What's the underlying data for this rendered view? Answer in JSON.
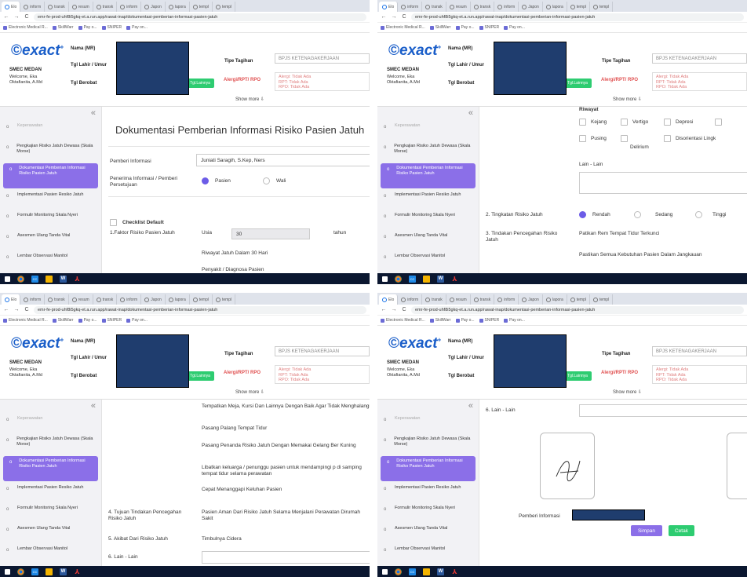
{
  "browser": {
    "tabs": [
      "Elo",
      "inform",
      "transk",
      "resum",
      "transk",
      "inform",
      "Japon",
      "lapora",
      "templ",
      "templ"
    ],
    "url": "emr-fe-prod-uhf8i5gkq-et.a.run.app/rawat-inap/dokumentasi-pemberian-informasi-pasien-jatuh",
    "bookmarks": [
      "Electronic Medical R...",
      "SkillWarr",
      "Pay o...",
      "SNIPER",
      "Pay on..."
    ]
  },
  "header": {
    "logo": "exact",
    "logo_sup": "+",
    "clinic": "SMEC MEDAN",
    "welcome": "Welcome, Eka Oktafianita, A.Md",
    "labels": {
      "nama": "Nama (MR)",
      "tgl_lahir": "Tgl Lahir / Umur",
      "tgl_berobat": "Tgl Berobat",
      "tipe": "Tipe Tagihan",
      "alergi": "Alergi/RPT/ RPO"
    },
    "tgl_lainnya": "Tgl.Lainnya",
    "tipe_value": "BPJS KETENAGAKERJAAN",
    "alergi_lines": [
      "Alergi: Tidak Ada",
      "RPT: Tidak Ada",
      "RPO: Tidak Ada"
    ],
    "show_more": "Show more ⇩"
  },
  "sidebar": {
    "items": [
      {
        "label": "Keperawatan",
        "state": "faded"
      },
      {
        "label": "Pengkajian Risiko Jatuh Dewasa (Skala Morse)",
        "state": "normal"
      },
      {
        "label": "Dokumentasi Pemberian Informasi Risiko Pasien Jatuh",
        "state": "active"
      },
      {
        "label": "Implementasi Pasien Resiko Jatuh",
        "state": "normal"
      },
      {
        "label": "Formulir Monitoring Skala Nyeri",
        "state": "normal"
      },
      {
        "label": "Asesmen Ulang Tanda Vital",
        "state": "normal"
      },
      {
        "label": "Lembar Observasi Manitol",
        "state": "normal"
      }
    ]
  },
  "q1": {
    "title": "Dokumentasi Pemberian Informasi Risiko Pasien Jatuh",
    "pemberi_label": "Pemberi Informasi",
    "pemberi_value": "Juniati Saragih, S.Kep, Ners",
    "penerima_label": "Penerima Informasi / Pemberi Persetujuan",
    "opt_pasien": "Pasien",
    "opt_wali": "Wali",
    "checklist": "Checklist Default",
    "faktor": "1.Faktor Risiko Pasien Jatuh",
    "usia_label": "Usia",
    "usia_value": "30",
    "usia_unit": "tahun",
    "riwayat": "Riwayat Jatuh Dalam 30 Hari",
    "penyakit": "Penyakit / Diagnosa Pasien"
  },
  "q2": {
    "riwayat": "Riwayat",
    "opts": [
      "Kejang",
      "Vertigo",
      "Depresi",
      "Pusing",
      "Disorientasi Lingk",
      "Delirium"
    ],
    "lain": "Lain - Lain",
    "tingkatan": "2. Tingkatan Risiko Jatuh",
    "rendah": "Rendah",
    "sedang": "Sedang",
    "tinggi": "Tinggi",
    "tindakan": "3. Tindakan Pencegahan Risiko Jatuh",
    "t1": "Patikan Rem Tempat Tidur Terkunci",
    "t2": "Pastikan Semua Kebutuhan Pasien Dalam Jangkauan"
  },
  "q3": {
    "lines": [
      "Tempatkan Meja, Kursi Dan Lainnya Dengan Baik Agar Tidak Menghalangi",
      "Pasang Palang Tempat Tidur",
      "Pasang Penanda Risiko Jatuh Dengan Memakai Gelang Ber Kuning",
      "Libatkan keluarga / penunggu pasien untuk mendampingi p di samping tempat tidur selama perawatan",
      "Cepat Menanggapi Keluhan Pasien"
    ],
    "tujuan_label": "4. Tujuan Tindakan Pencegahan Risiko Jatuh",
    "tujuan_value": "Pasien Aman Dari Risiko Jatuh Selama Menjalani Perawatan Dirumah Sakit",
    "akibat_label": "5. Akibat Dari Risiko Jatuh",
    "akibat_value": "Timbulnya Cidera",
    "lain_label": "6. Lain - Lain"
  },
  "q4": {
    "lain_label": "6. Lain - Lain",
    "pemberi_label": "Pemberi Informasi",
    "simpan": "Simpan",
    "cetak": "Cetak"
  }
}
